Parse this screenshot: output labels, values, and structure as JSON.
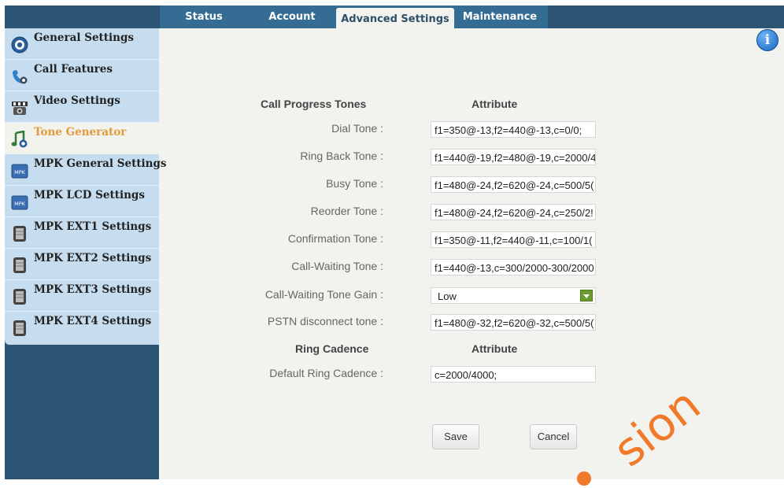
{
  "tabs": [
    {
      "label": "Status"
    },
    {
      "label": "Account"
    },
    {
      "label": "Advanced Settings",
      "active": true
    },
    {
      "label": "Maintenance"
    }
  ],
  "sidebar": {
    "items": [
      {
        "label": "General Settings",
        "icon": "gear-icon"
      },
      {
        "label": "Call Features",
        "icon": "phone-icon"
      },
      {
        "label": "Video Settings",
        "icon": "video-icon"
      },
      {
        "label": "Tone Generator",
        "icon": "music-note-icon",
        "active": true
      },
      {
        "label": "MPK General Settings",
        "icon": "mpk-icon"
      },
      {
        "label": "MPK LCD Settings",
        "icon": "mpk-icon"
      },
      {
        "label": "MPK EXT1 Settings",
        "icon": "extension-module-icon"
      },
      {
        "label": "MPK EXT2 Settings",
        "icon": "extension-module-icon"
      },
      {
        "label": "MPK EXT3 Settings",
        "icon": "extension-module-icon"
      },
      {
        "label": "MPK EXT4 Settings",
        "icon": "extension-module-icon"
      }
    ]
  },
  "info_icon": "i",
  "section1": {
    "title": "Call Progress Tones",
    "attr_header": "Attribute"
  },
  "fields": [
    {
      "label": "Dial Tone :",
      "value": "f1=350@-13,f2=440@-13,c=0/0;"
    },
    {
      "label": "Ring Back Tone :",
      "value": "f1=440@-19,f2=480@-19,c=2000/4"
    },
    {
      "label": "Busy Tone :",
      "value": "f1=480@-24,f2=620@-24,c=500/5("
    },
    {
      "label": "Reorder Tone :",
      "value": "f1=480@-24,f2=620@-24,c=250/2!"
    },
    {
      "label": "Confirmation Tone :",
      "value": "f1=350@-11,f2=440@-11,c=100/1("
    },
    {
      "label": "Call-Waiting Tone :",
      "value": "f1=440@-13,c=300/2000-300/2000"
    }
  ],
  "gain": {
    "label": "Call-Waiting Tone Gain :",
    "value": "Low"
  },
  "pstn": {
    "label": "PSTN disconnect tone :",
    "value": "f1=480@-32,f2=620@-32,c=500/5("
  },
  "section2": {
    "title": "Ring Cadence",
    "attr_header": "Attribute"
  },
  "cadence": {
    "label": "Default Ring Cadence :",
    "value": "c=2000/4000;"
  },
  "buttons": {
    "save": "Save",
    "cancel": "Cancel"
  },
  "watermark": "sion",
  "colors": {
    "topbar": "#2e5473",
    "tabbar": "#356c93",
    "sidebar_menu": "#c6ddef",
    "active_item": "#e29a3a",
    "watermark": "#f07a2a"
  }
}
